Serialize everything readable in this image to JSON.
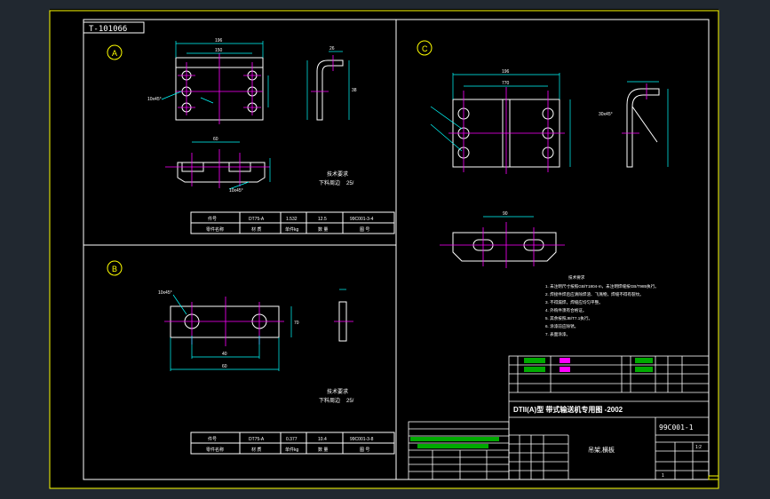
{
  "drawing_number_tag": "T-101066",
  "views": {
    "a": "A",
    "b": "B",
    "c": "C"
  },
  "notes": {
    "tech_req_title": "技术要求",
    "edge_note": "下料周边",
    "roughness": "25/",
    "chamfer_a": "10x45°",
    "chamfer_b": "10x45°",
    "chamfer_c": "30x45°"
  },
  "dims": {
    "a_w": "196",
    "a_i": "150",
    "a_h": "90",
    "a_s": "26",
    "a_r": "38",
    "a_cl": "60",
    "c_w": "196",
    "c_i": "770",
    "c_bot": "90",
    "b_w": "60",
    "b_i": "40",
    "b_h": "70"
  },
  "mat_table_a": {
    "row1": [
      "件号",
      "DT75-A",
      "1.532",
      "12.5",
      "99C001-3-4"
    ],
    "row2": [
      "零件名称",
      "材 质",
      "单件kg",
      "数 量",
      "图 号"
    ]
  },
  "mat_table_b": {
    "row1": [
      "件号",
      "DT75-A",
      "0.377",
      "10.4",
      "99C001-3-8"
    ],
    "row2": [
      "零件名称",
      "材 质",
      "单件kg",
      "数 量",
      "图 号"
    ]
  },
  "tech_notes": [
    "技术要求",
    "1. 未注明尺寸按照GB/T1804-m，未注明焊缝按GB/T985执行。",
    "2. 焊接件焊后应清除焊渣、飞溅物，焊缝不得有裂纹。",
    "3. 不得漏焊，焊缝应均匀平整。",
    "4. 外购件须有合格证。",
    "5. 其余按照JB/T7.1执行。",
    "6. 涂漆前应除锈。",
    "7. 表面涂漆。"
  ],
  "title_block": {
    "title": "DTII(A)型  带式输送机专用图 -2002",
    "code": "99C001-1",
    "part_name": "吊架,横板",
    "scale": "1:2",
    "sheet": "1"
  }
}
